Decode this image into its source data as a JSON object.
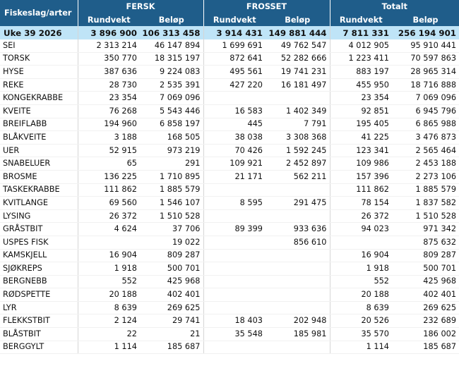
{
  "header": {
    "corner": "Fiskeslag/arter",
    "groups": [
      "FERSK",
      "FROSSET",
      "Totalt"
    ],
    "sub": [
      "Rundvekt",
      "Beløp",
      "Rundvekt",
      "Beløp",
      "Rundvekt",
      "Beløp"
    ]
  },
  "total": [
    "Uke 39 2026",
    "3 896 900",
    "106 313 458",
    "3 914 431",
    "149 881 444",
    "7 811 331",
    "256 194 901"
  ],
  "rows": [
    [
      "SEI",
      "2 313 214",
      "46 147 894",
      "1 699 691",
      "49 762 547",
      "4 012 905",
      "95 910 441"
    ],
    [
      "TORSK",
      "350 770",
      "18 315 197",
      "872 641",
      "52 282 666",
      "1 223 411",
      "70 597 863"
    ],
    [
      "HYSE",
      "387 636",
      "9 224 083",
      "495 561",
      "19 741 231",
      "883 197",
      "28 965 314"
    ],
    [
      "REKE",
      "28 730",
      "2 535 391",
      "427 220",
      "16 181 497",
      "455 950",
      "18 716 888"
    ],
    [
      "KONGEKRABBE",
      "23 354",
      "7 069 096",
      "",
      "",
      "23 354",
      "7 069 096"
    ],
    [
      "KVEITE",
      "76 268",
      "5 543 446",
      "16 583",
      "1 402 349",
      "92 851",
      "6 945 796"
    ],
    [
      "BREIFLABB",
      "194 960",
      "6 858 197",
      "445",
      "7 791",
      "195 405",
      "6 865 988"
    ],
    [
      "BLÅKVEITE",
      "3 188",
      "168 505",
      "38 038",
      "3 308 368",
      "41 225",
      "3 476 873"
    ],
    [
      "UER",
      "52 915",
      "973 219",
      "70 426",
      "1 592 245",
      "123 341",
      "2 565 464"
    ],
    [
      "SNABELUER",
      "65",
      "291",
      "109 921",
      "2 452 897",
      "109 986",
      "2 453 188"
    ],
    [
      "BROSME",
      "136 225",
      "1 710 895",
      "21 171",
      "562 211",
      "157 396",
      "2 273 106"
    ],
    [
      "TASKEKRABBE",
      "111 862",
      "1 885 579",
      "",
      "",
      "111 862",
      "1 885 579"
    ],
    [
      "KVITLANGE",
      "69 560",
      "1 546 107",
      "8 595",
      "291 475",
      "78 154",
      "1 837 582"
    ],
    [
      "LYSING",
      "26 372",
      "1 510 528",
      "",
      "",
      "26 372",
      "1 510 528"
    ],
    [
      "GRÅSTBIT",
      "4 624",
      "37 706",
      "89 399",
      "933 636",
      "94 023",
      "971 342"
    ],
    [
      "USPES FISK",
      "",
      "19 022",
      "",
      "856 610",
      "",
      "875 632"
    ],
    [
      "KAMSKJELL",
      "16 904",
      "809 287",
      "",
      "",
      "16 904",
      "809 287"
    ],
    [
      "SJØKREPS",
      "1 918",
      "500 701",
      "",
      "",
      "1 918",
      "500 701"
    ],
    [
      "BERGNEBB",
      "552",
      "425 968",
      "",
      "",
      "552",
      "425 968"
    ],
    [
      "RØDSPETTE",
      "20 188",
      "402 401",
      "",
      "",
      "20 188",
      "402 401"
    ],
    [
      "LYR",
      "8 639",
      "269 625",
      "",
      "",
      "8 639",
      "269 625"
    ],
    [
      "FLEKKSTBIT",
      "2 124",
      "29 741",
      "18 403",
      "202 948",
      "20 526",
      "232 689"
    ],
    [
      "BLÅSTBIT",
      "22",
      "21",
      "35 548",
      "185 981",
      "35 570",
      "186 002"
    ],
    [
      "BERGGYLT",
      "1 114",
      "185 687",
      "",
      "",
      "1 114",
      "185 687"
    ]
  ]
}
